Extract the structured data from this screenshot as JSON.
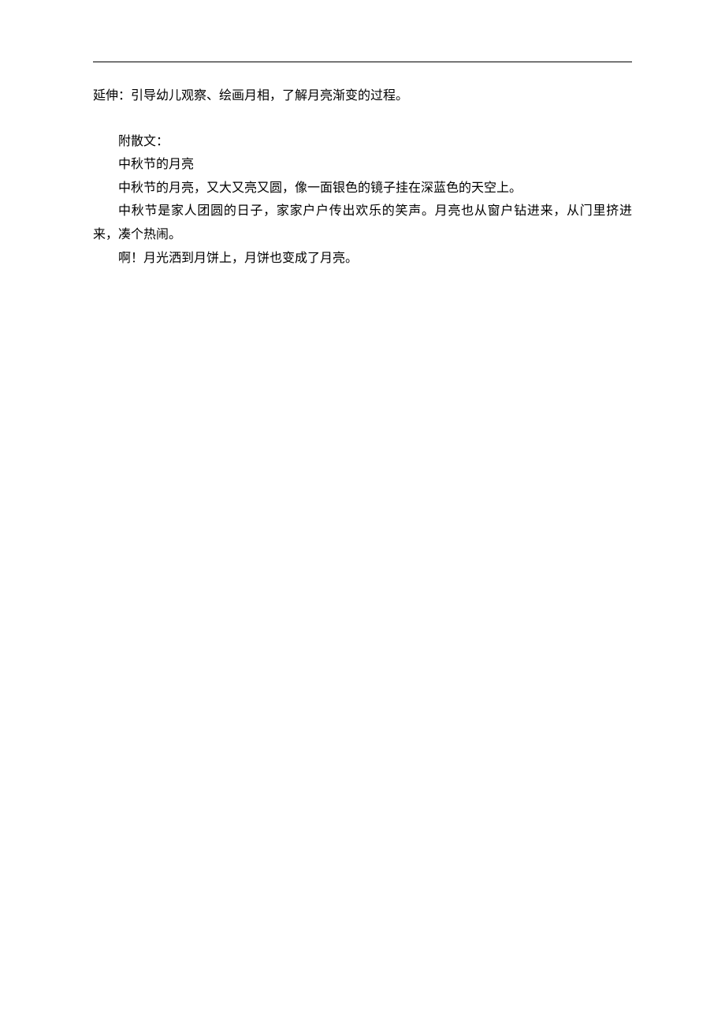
{
  "doc": {
    "extension": "延伸：引导幼儿观察、绘画月相，了解月亮渐变的过程。",
    "attach_label": "附散文：",
    "title": "中秋节的月亮",
    "p1": "中秋节的月亮，又大又亮又圆，像一面银色的镜子挂在深蓝色的天空上。",
    "p2": "中秋节是家人团圆的日子，家家户户传出欢乐的笑声。月亮也从窗户钻进来，从门里挤进来，凑个热闹。",
    "p3": "啊！月光洒到月饼上，月饼也变成了月亮。"
  }
}
